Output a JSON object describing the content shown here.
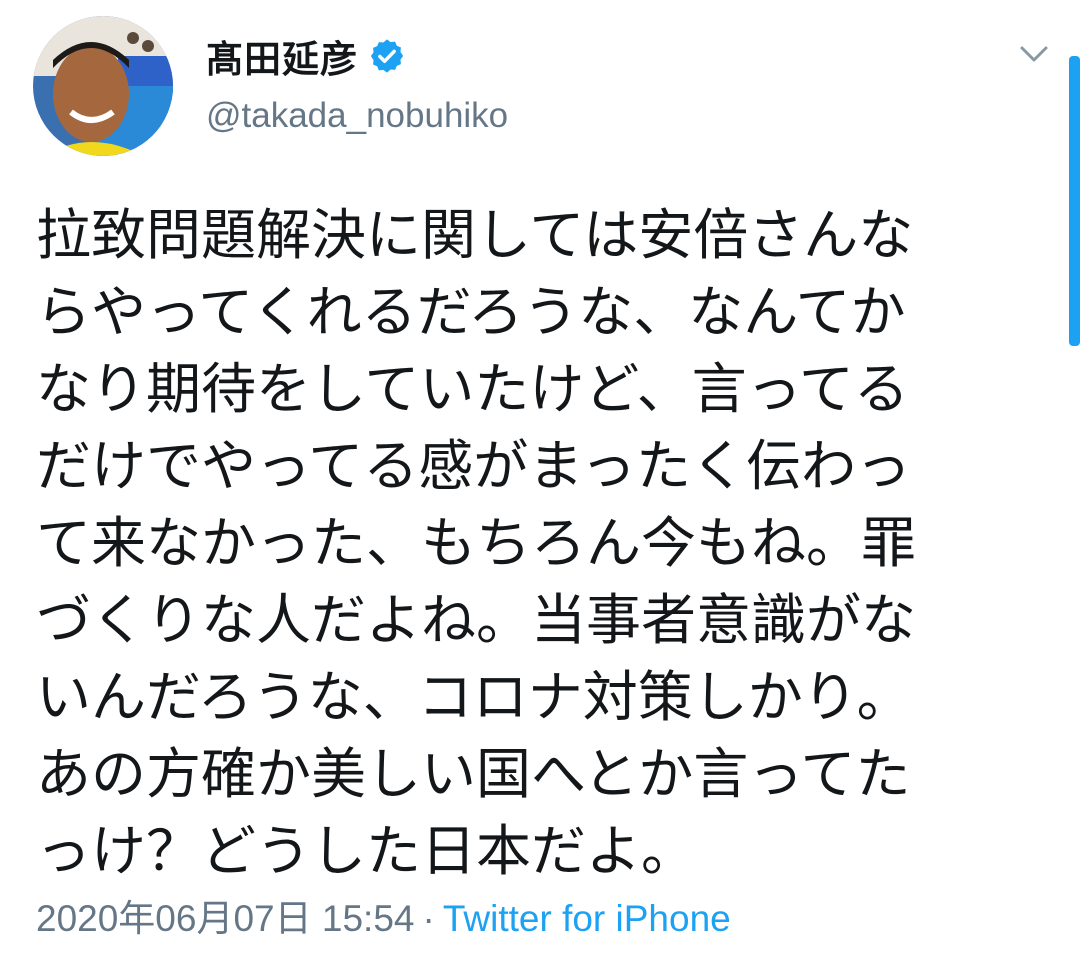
{
  "user": {
    "display_name": "髙田延彦",
    "handle": "@takada_nobuhiko",
    "verified_icon": "verified-badge-icon",
    "avatar_icon": "avatar-photo"
  },
  "tweet": {
    "lines": [
      "拉致問題解決に関しては安倍さんな",
      "らやってくれるだろうな、なんてか",
      "なり期待をしていたけど、言ってる",
      "だけでやってる感がまったく伝わっ",
      "て来なかった、もちろん今もね。罪",
      "づくりな人だよね。当事者意識がな",
      "いんだろうな、コロナ対策しかり。",
      "あの方確か美しい国へとか言ってた",
      "っけ？どうした日本だよ。"
    ]
  },
  "meta": {
    "timestamp": "2020年06月07日 15:54",
    "separator": "·",
    "source": "Twitter for iPhone"
  },
  "colors": {
    "text": "#14171a",
    "secondary": "#657786",
    "accent": "#1da1f2"
  },
  "menu_icon": "chevron-down-icon"
}
